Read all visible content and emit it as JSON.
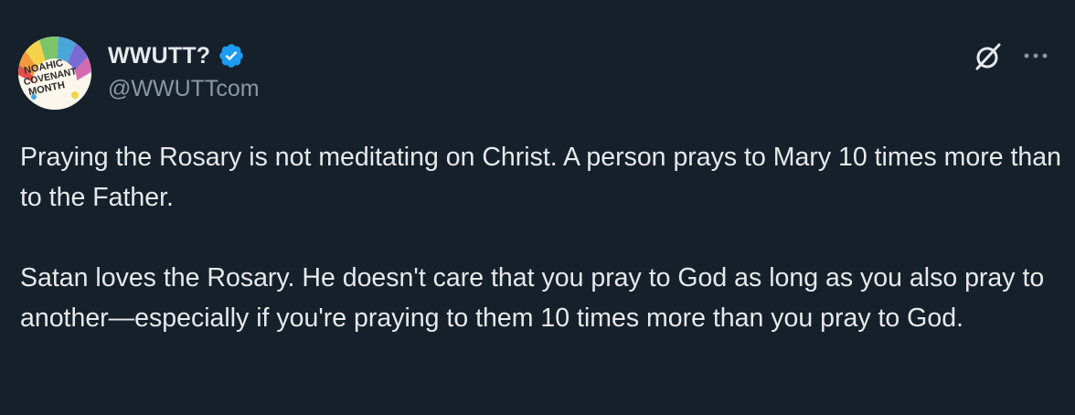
{
  "tweet": {
    "author": {
      "display_name": "WWUTT?",
      "handle": "@WWUTTcom",
      "verified": true,
      "avatar_text": [
        "NOAHIC",
        "COVENANT",
        "MONTH"
      ]
    },
    "paragraphs": [
      "Praying the Rosary is not meditating on Christ. A person prays to Mary 10 times more than to the Father.",
      "Satan loves the Rosary. He doesn't care that you pray to God as long as you also pray to another—especially if you're praying to them 10 times more than you pray to God."
    ]
  },
  "icons": {
    "grok": "grok-icon",
    "more": "more-options-icon",
    "verified": "verified-badge-icon"
  },
  "colors": {
    "background": "#15202b",
    "text_primary": "#e7e9ea",
    "text_secondary": "#8b98a5",
    "verified_blue": "#1d9bf0"
  }
}
